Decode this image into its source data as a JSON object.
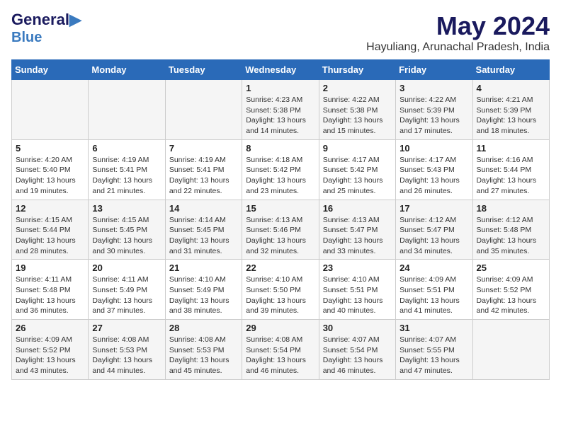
{
  "header": {
    "logo_line1": "General",
    "logo_line2": "Blue",
    "month_year": "May 2024",
    "location": "Hayuliang, Arunachal Pradesh, India"
  },
  "days_of_week": [
    "Sunday",
    "Monday",
    "Tuesday",
    "Wednesday",
    "Thursday",
    "Friday",
    "Saturday"
  ],
  "weeks": [
    [
      {
        "day": "",
        "info": ""
      },
      {
        "day": "",
        "info": ""
      },
      {
        "day": "",
        "info": ""
      },
      {
        "day": "1",
        "info": "Sunrise: 4:23 AM\nSunset: 5:38 PM\nDaylight: 13 hours\nand 14 minutes."
      },
      {
        "day": "2",
        "info": "Sunrise: 4:22 AM\nSunset: 5:38 PM\nDaylight: 13 hours\nand 15 minutes."
      },
      {
        "day": "3",
        "info": "Sunrise: 4:22 AM\nSunset: 5:39 PM\nDaylight: 13 hours\nand 17 minutes."
      },
      {
        "day": "4",
        "info": "Sunrise: 4:21 AM\nSunset: 5:39 PM\nDaylight: 13 hours\nand 18 minutes."
      }
    ],
    [
      {
        "day": "5",
        "info": "Sunrise: 4:20 AM\nSunset: 5:40 PM\nDaylight: 13 hours\nand 19 minutes."
      },
      {
        "day": "6",
        "info": "Sunrise: 4:19 AM\nSunset: 5:41 PM\nDaylight: 13 hours\nand 21 minutes."
      },
      {
        "day": "7",
        "info": "Sunrise: 4:19 AM\nSunset: 5:41 PM\nDaylight: 13 hours\nand 22 minutes."
      },
      {
        "day": "8",
        "info": "Sunrise: 4:18 AM\nSunset: 5:42 PM\nDaylight: 13 hours\nand 23 minutes."
      },
      {
        "day": "9",
        "info": "Sunrise: 4:17 AM\nSunset: 5:42 PM\nDaylight: 13 hours\nand 25 minutes."
      },
      {
        "day": "10",
        "info": "Sunrise: 4:17 AM\nSunset: 5:43 PM\nDaylight: 13 hours\nand 26 minutes."
      },
      {
        "day": "11",
        "info": "Sunrise: 4:16 AM\nSunset: 5:44 PM\nDaylight: 13 hours\nand 27 minutes."
      }
    ],
    [
      {
        "day": "12",
        "info": "Sunrise: 4:15 AM\nSunset: 5:44 PM\nDaylight: 13 hours\nand 28 minutes."
      },
      {
        "day": "13",
        "info": "Sunrise: 4:15 AM\nSunset: 5:45 PM\nDaylight: 13 hours\nand 30 minutes."
      },
      {
        "day": "14",
        "info": "Sunrise: 4:14 AM\nSunset: 5:45 PM\nDaylight: 13 hours\nand 31 minutes."
      },
      {
        "day": "15",
        "info": "Sunrise: 4:13 AM\nSunset: 5:46 PM\nDaylight: 13 hours\nand 32 minutes."
      },
      {
        "day": "16",
        "info": "Sunrise: 4:13 AM\nSunset: 5:47 PM\nDaylight: 13 hours\nand 33 minutes."
      },
      {
        "day": "17",
        "info": "Sunrise: 4:12 AM\nSunset: 5:47 PM\nDaylight: 13 hours\nand 34 minutes."
      },
      {
        "day": "18",
        "info": "Sunrise: 4:12 AM\nSunset: 5:48 PM\nDaylight: 13 hours\nand 35 minutes."
      }
    ],
    [
      {
        "day": "19",
        "info": "Sunrise: 4:11 AM\nSunset: 5:48 PM\nDaylight: 13 hours\nand 36 minutes."
      },
      {
        "day": "20",
        "info": "Sunrise: 4:11 AM\nSunset: 5:49 PM\nDaylight: 13 hours\nand 37 minutes."
      },
      {
        "day": "21",
        "info": "Sunrise: 4:10 AM\nSunset: 5:49 PM\nDaylight: 13 hours\nand 38 minutes."
      },
      {
        "day": "22",
        "info": "Sunrise: 4:10 AM\nSunset: 5:50 PM\nDaylight: 13 hours\nand 39 minutes."
      },
      {
        "day": "23",
        "info": "Sunrise: 4:10 AM\nSunset: 5:51 PM\nDaylight: 13 hours\nand 40 minutes."
      },
      {
        "day": "24",
        "info": "Sunrise: 4:09 AM\nSunset: 5:51 PM\nDaylight: 13 hours\nand 41 minutes."
      },
      {
        "day": "25",
        "info": "Sunrise: 4:09 AM\nSunset: 5:52 PM\nDaylight: 13 hours\nand 42 minutes."
      }
    ],
    [
      {
        "day": "26",
        "info": "Sunrise: 4:09 AM\nSunset: 5:52 PM\nDaylight: 13 hours\nand 43 minutes."
      },
      {
        "day": "27",
        "info": "Sunrise: 4:08 AM\nSunset: 5:53 PM\nDaylight: 13 hours\nand 44 minutes."
      },
      {
        "day": "28",
        "info": "Sunrise: 4:08 AM\nSunset: 5:53 PM\nDaylight: 13 hours\nand 45 minutes."
      },
      {
        "day": "29",
        "info": "Sunrise: 4:08 AM\nSunset: 5:54 PM\nDaylight: 13 hours\nand 46 minutes."
      },
      {
        "day": "30",
        "info": "Sunrise: 4:07 AM\nSunset: 5:54 PM\nDaylight: 13 hours\nand 46 minutes."
      },
      {
        "day": "31",
        "info": "Sunrise: 4:07 AM\nSunset: 5:55 PM\nDaylight: 13 hours\nand 47 minutes."
      },
      {
        "day": "",
        "info": ""
      }
    ]
  ]
}
